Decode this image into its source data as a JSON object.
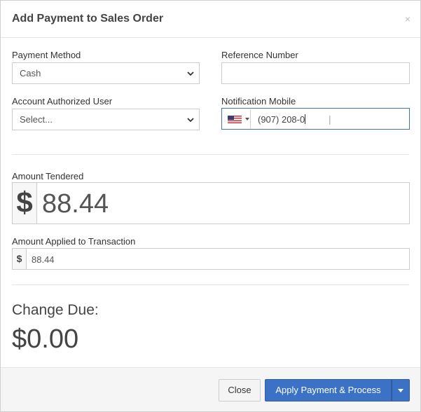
{
  "dialog": {
    "title": "Add Payment to Sales Order",
    "close_glyph": "×"
  },
  "form": {
    "payment_method": {
      "label": "Payment Method",
      "value": "Cash"
    },
    "reference_number": {
      "label": "Reference Number",
      "value": ""
    },
    "authorized_user": {
      "label": "Account Authorized User",
      "value": "Select..."
    },
    "notification_mobile": {
      "label": "Notification Mobile",
      "country": "US",
      "value": "(907) 208-0"
    },
    "amount_tendered": {
      "label": "Amount Tendered",
      "currency_symbol": "$",
      "value": "88.44"
    },
    "amount_applied": {
      "label": "Amount Applied to Transaction",
      "currency_symbol": "$",
      "value": "88.44"
    }
  },
  "summary": {
    "change_due_label": "Change Due:",
    "change_due_value": "$0.00"
  },
  "footer": {
    "close_label": "Close",
    "apply_label": "Apply Payment & Process"
  },
  "colors": {
    "primary": "#3c72c6",
    "focus_border": "#3f73b3",
    "footer_bg": "#f5f5f5"
  },
  "icons": {
    "flag": "us-flag-icon",
    "caret": "chevron-down-icon",
    "dropdown": "caret-down-icon"
  }
}
